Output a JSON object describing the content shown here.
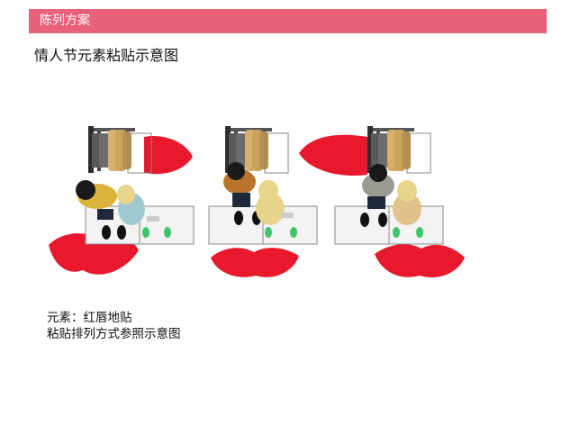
{
  "header": {
    "title": "陈列方案",
    "color": "#e9617a"
  },
  "subtitle": "情人节元素粘贴示意图",
  "notes": {
    "line1": "元素：红唇地贴",
    "line2": "粘贴排列方式参照示意图"
  },
  "colors": {
    "lip_red": "#e8192c",
    "mat_white": "#f3f3f3",
    "rack_dark": "#3a3a3a",
    "clothes_tan": "#d8b06a"
  },
  "scenes": [
    {
      "male_shirt_color": "#d9b33a",
      "female_top_color": "#9fc9d0"
    },
    {
      "male_shirt_color": "#b8752b",
      "female_top_color": "#e7d38a"
    },
    {
      "male_shirt_color": "#9a9a90",
      "female_top_color": "#e0c28a"
    }
  ]
}
